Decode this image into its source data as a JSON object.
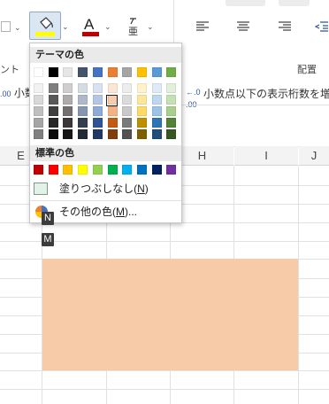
{
  "ribbon": {
    "group_font_label_fragment": "ント",
    "group_align_label": "配置",
    "decimal_increase_fragment": "小数",
    "decimal_decrease_label": "小数点以下の表示桁数を増や"
  },
  "colors": {
    "accent_fill": "#ffff00",
    "font_color": "#c00000",
    "selection_fill": "#f8cba8"
  },
  "columns": {
    "e": "E",
    "h": "H",
    "i": "I",
    "j": "J"
  },
  "dropdown": {
    "theme_title": "テーマの色",
    "standard_title": "標準の色",
    "no_fill_label": "塗りつぶしなし(",
    "no_fill_key": "N",
    "no_fill_close": ")",
    "more_colors_label": "その他の色(",
    "more_colors_key": "M",
    "more_colors_close": ")...",
    "keytip_n": "N",
    "keytip_m": "M",
    "theme_top": [
      "#ffffff",
      "#000000",
      "#e7e6e6",
      "#44546a",
      "#4472c4",
      "#ed7d31",
      "#a5a5a5",
      "#ffc000",
      "#5b9bd5",
      "#70ad47"
    ],
    "theme_shades": [
      [
        "#f2f2f2",
        "#7f7f7f",
        "#d0cece",
        "#d6dce4",
        "#d9e2f3",
        "#fbe5d5",
        "#ededed",
        "#fff2cc",
        "#deebf6",
        "#e2efd9"
      ],
      [
        "#d8d8d8",
        "#595959",
        "#aeabab",
        "#adb9ca",
        "#b4c6e7",
        "#f7cbac",
        "#dbdbdb",
        "#fee599",
        "#bdd7ee",
        "#c5e0b3"
      ],
      [
        "#bfbfbf",
        "#3f3f3f",
        "#757070",
        "#8496b0",
        "#8eaadb",
        "#f4b183",
        "#c9c9c9",
        "#ffd965",
        "#9cc3e5",
        "#a8d08d"
      ],
      [
        "#a5a5a5",
        "#262626",
        "#3a3838",
        "#323f4f",
        "#2f5496",
        "#c55a11",
        "#7b7b7b",
        "#bf8f00",
        "#2e75b5",
        "#538135"
      ],
      [
        "#7f7f7f",
        "#0c0c0c",
        "#171616",
        "#222a35",
        "#1f3864",
        "#833c0b",
        "#525252",
        "#7f6000",
        "#1e4e79",
        "#375623"
      ]
    ],
    "standard": [
      "#c00000",
      "#ff0000",
      "#ffc000",
      "#ffff00",
      "#92d050",
      "#00b050",
      "#00b0f0",
      "#0070c0",
      "#002060",
      "#7030a0"
    ]
  }
}
